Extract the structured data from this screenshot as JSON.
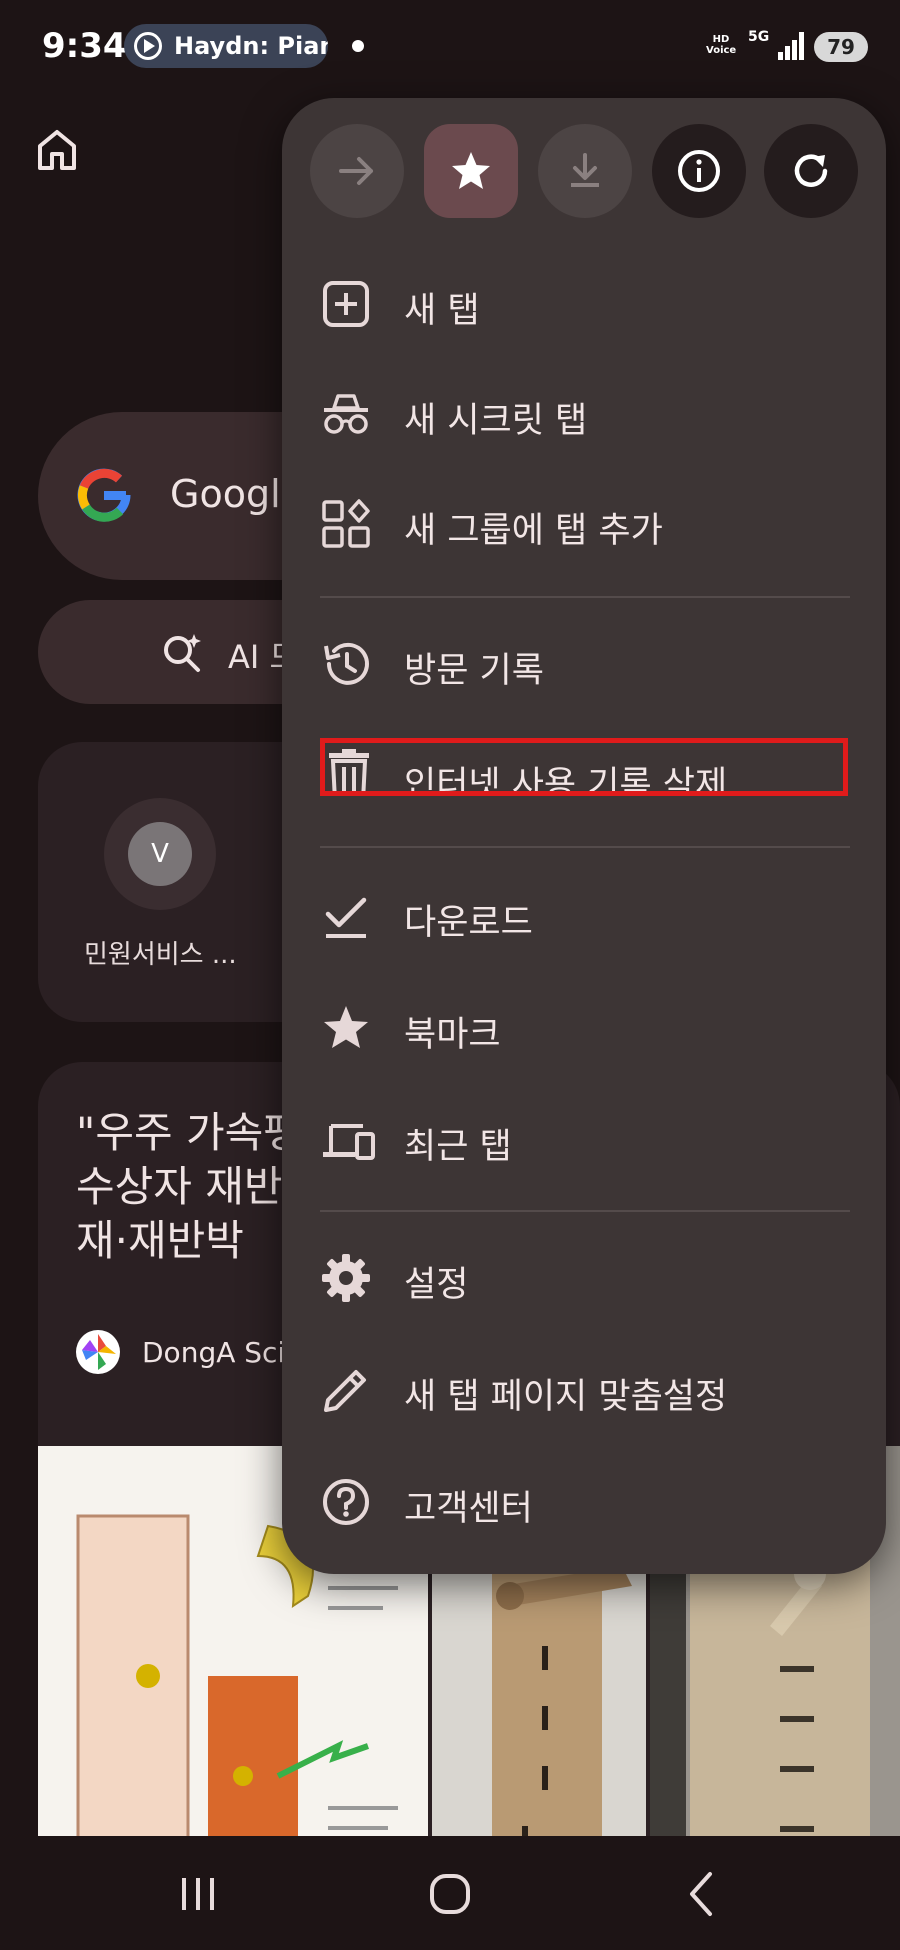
{
  "status_bar": {
    "time": "9:34",
    "media_title": "Haydn: Piano",
    "hd_voice": "HD\nVoice",
    "network": "5G",
    "battery": "79"
  },
  "background_page": {
    "search_placeholder": "Google",
    "ai_mode_label": "AI 모",
    "shortcut": {
      "letter": "V",
      "label": "민원서비스 ..."
    },
    "news": {
      "headline": "\"우주 가속팽\n수상자 재반\n재·재반박",
      "source": "DongA Scie"
    }
  },
  "menu": {
    "toolbar": {
      "forward": "arrow-forward-icon",
      "bookmark": "star-icon",
      "download": "download-icon",
      "info": "info-icon",
      "refresh": "refresh-icon"
    },
    "items": [
      {
        "label": "새 탭",
        "icon": "add-box-icon"
      },
      {
        "label": "새 시크릿 탭",
        "icon": "incognito-icon"
      },
      {
        "label": "새 그룹에 탭 추가",
        "icon": "tab-group-icon"
      },
      {
        "label": "방문 기록",
        "icon": "history-icon"
      },
      {
        "label": "인터넷 사용 기록 삭제",
        "icon": "trash-icon"
      },
      {
        "label": "다운로드",
        "icon": "download-done-icon"
      },
      {
        "label": "북마크",
        "icon": "star-icon"
      },
      {
        "label": "최근 탭",
        "icon": "devices-icon"
      },
      {
        "label": "설정",
        "icon": "gear-icon"
      },
      {
        "label": "새 탭 페이지 맞춤설정",
        "icon": "pencil-icon"
      },
      {
        "label": "고객센터",
        "icon": "help-icon"
      }
    ],
    "highlight_color": "#e01b1b"
  }
}
